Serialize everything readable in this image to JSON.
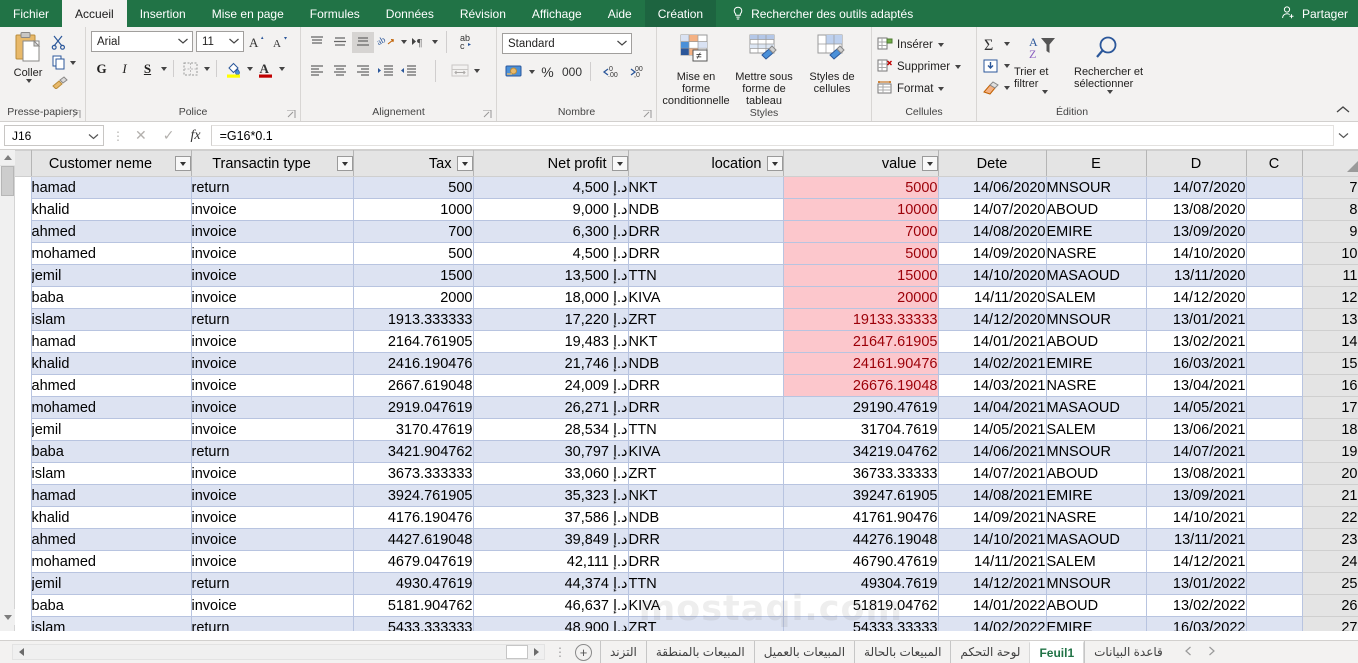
{
  "ribbon": {
    "tabs": [
      {
        "label": "Fichier",
        "active": false,
        "contextual": false
      },
      {
        "label": "Accueil",
        "active": true,
        "contextual": false
      },
      {
        "label": "Insertion",
        "active": false,
        "contextual": false
      },
      {
        "label": "Mise en page",
        "active": false,
        "contextual": false
      },
      {
        "label": "Formules",
        "active": false,
        "contextual": false
      },
      {
        "label": "Données",
        "active": false,
        "contextual": false
      },
      {
        "label": "Révision",
        "active": false,
        "contextual": false
      },
      {
        "label": "Affichage",
        "active": false,
        "contextual": false
      },
      {
        "label": "Aide",
        "active": false,
        "contextual": false
      },
      {
        "label": "Création",
        "active": false,
        "contextual": true
      }
    ],
    "tellme": "Rechercher des outils adaptés",
    "share": "Partager",
    "groups": {
      "clipboard": {
        "label": "Presse-papiers",
        "paste": "Coller"
      },
      "font": {
        "label": "Police",
        "font_name": "Arial",
        "font_size": "11",
        "bold": "G",
        "italic": "I",
        "underline": "S"
      },
      "alignment": {
        "label": "Alignement"
      },
      "number": {
        "label": "Nombre",
        "format": "Standard",
        "percent": "%",
        "thousands": "000"
      },
      "styles": {
        "label": "Styles",
        "conditional": "Mise en forme conditionnelle",
        "table": "Mettre sous forme de tableau",
        "cells": "Styles de cellules"
      },
      "cells": {
        "label": "Cellules",
        "insert": "Insérer",
        "delete": "Supprimer",
        "format": "Format"
      },
      "editing": {
        "label": "Édition",
        "sort_filter": "Trier et filtrer",
        "find_select": "Rechercher et sélectionner"
      }
    }
  },
  "formula_bar": {
    "name_box": "J16",
    "formula": "=G16*0.1"
  },
  "sheet": {
    "headers": [
      {
        "label": "Customer neme",
        "filter": true,
        "align": "center"
      },
      {
        "label": "Transactin type",
        "filter": true,
        "align": "center"
      },
      {
        "label": "Tax",
        "filter": true,
        "align": "right"
      },
      {
        "label": "Net profit",
        "filter": true,
        "align": "right"
      },
      {
        "label": "location",
        "filter": true,
        "align": "right"
      },
      {
        "label": "value",
        "filter": true,
        "align": "right"
      },
      {
        "label": "Dete",
        "filter": false,
        "align": "center"
      },
      {
        "label": "E",
        "filter": false,
        "align": "center"
      },
      {
        "label": "D",
        "filter": false,
        "align": "center"
      },
      {
        "label": "C",
        "filter": false,
        "align": "center"
      }
    ],
    "currency_symbol": "د.إ",
    "rows": [
      {
        "n": "7",
        "customer": "hamad",
        "type": "return",
        "tax": "500",
        "profit": "4,500",
        "location": "NKT",
        "value": "5000",
        "date": "14/06/2020",
        "e": "MNSOUR",
        "d": "14/07/2020",
        "c": "",
        "pink": true
      },
      {
        "n": "8",
        "customer": "khalid",
        "type": "invoice",
        "tax": "1000",
        "profit": "9,000",
        "location": "NDB",
        "value": "10000",
        "date": "14/07/2020",
        "e": "ABOUD",
        "d": "13/08/2020",
        "c": "",
        "pink": true
      },
      {
        "n": "9",
        "customer": "ahmed",
        "type": "invoice",
        "tax": "700",
        "profit": "6,300",
        "location": "DRR",
        "value": "7000",
        "date": "14/08/2020",
        "e": "EMIRE",
        "d": "13/09/2020",
        "c": "",
        "pink": true
      },
      {
        "n": "10",
        "customer": "mohamed",
        "type": "invoice",
        "tax": "500",
        "profit": "4,500",
        "location": "DRR",
        "value": "5000",
        "date": "14/09/2020",
        "e": "NASRE",
        "d": "14/10/2020",
        "c": "",
        "pink": true
      },
      {
        "n": "11",
        "customer": "jemil",
        "type": "invoice",
        "tax": "1500",
        "profit": "13,500",
        "location": "TTN",
        "value": "15000",
        "date": "14/10/2020",
        "e": "MASAOUD",
        "d": "13/11/2020",
        "c": "",
        "pink": true
      },
      {
        "n": "12",
        "customer": "baba",
        "type": "invoice",
        "tax": "2000",
        "profit": "18,000",
        "location": "KIVA",
        "value": "20000",
        "date": "14/11/2020",
        "e": "SALEM",
        "d": "14/12/2020",
        "c": "",
        "pink": true
      },
      {
        "n": "13",
        "customer": "islam",
        "type": "return",
        "tax": "1913.333333",
        "profit": "17,220",
        "location": "ZRT",
        "value": "19133.33333",
        "date": "14/12/2020",
        "e": "MNSOUR",
        "d": "13/01/2021",
        "c": "",
        "pink": true
      },
      {
        "n": "14",
        "customer": "hamad",
        "type": "invoice",
        "tax": "2164.761905",
        "profit": "19,483",
        "location": "NKT",
        "value": "21647.61905",
        "date": "14/01/2021",
        "e": "ABOUD",
        "d": "13/02/2021",
        "c": "",
        "pink": true
      },
      {
        "n": "15",
        "customer": "khalid",
        "type": "invoice",
        "tax": "2416.190476",
        "profit": "21,746",
        "location": "NDB",
        "value": "24161.90476",
        "date": "14/02/2021",
        "e": "EMIRE",
        "d": "16/03/2021",
        "c": "",
        "pink": true
      },
      {
        "n": "16",
        "customer": "ahmed",
        "type": "invoice",
        "tax": "2667.619048",
        "profit": "24,009",
        "location": "DRR",
        "value": "26676.19048",
        "date": "14/03/2021",
        "e": "NASRE",
        "d": "13/04/2021",
        "c": "",
        "pink": true
      },
      {
        "n": "17",
        "customer": "mohamed",
        "type": "invoice",
        "tax": "2919.047619",
        "profit": "26,271",
        "location": "DRR",
        "value": "29190.47619",
        "date": "14/04/2021",
        "e": "MASAOUD",
        "d": "14/05/2021",
        "c": "",
        "pink": false
      },
      {
        "n": "18",
        "customer": "jemil",
        "type": "invoice",
        "tax": "3170.47619",
        "profit": "28,534",
        "location": "TTN",
        "value": "31704.7619",
        "date": "14/05/2021",
        "e": "SALEM",
        "d": "13/06/2021",
        "c": "",
        "pink": false
      },
      {
        "n": "19",
        "customer": "baba",
        "type": "return",
        "tax": "3421.904762",
        "profit": "30,797",
        "location": "KIVA",
        "value": "34219.04762",
        "date": "14/06/2021",
        "e": "MNSOUR",
        "d": "14/07/2021",
        "c": "",
        "pink": false
      },
      {
        "n": "20",
        "customer": "islam",
        "type": "invoice",
        "tax": "3673.333333",
        "profit": "33,060",
        "location": "ZRT",
        "value": "36733.33333",
        "date": "14/07/2021",
        "e": "ABOUD",
        "d": "13/08/2021",
        "c": "",
        "pink": false
      },
      {
        "n": "21",
        "customer": "hamad",
        "type": "invoice",
        "tax": "3924.761905",
        "profit": "35,323",
        "location": "NKT",
        "value": "39247.61905",
        "date": "14/08/2021",
        "e": "EMIRE",
        "d": "13/09/2021",
        "c": "",
        "pink": false
      },
      {
        "n": "22",
        "customer": "khalid",
        "type": "invoice",
        "tax": "4176.190476",
        "profit": "37,586",
        "location": "NDB",
        "value": "41761.90476",
        "date": "14/09/2021",
        "e": "NASRE",
        "d": "14/10/2021",
        "c": "",
        "pink": false
      },
      {
        "n": "23",
        "customer": "ahmed",
        "type": "invoice",
        "tax": "4427.619048",
        "profit": "39,849",
        "location": "DRR",
        "value": "44276.19048",
        "date": "14/10/2021",
        "e": "MASAOUD",
        "d": "13/11/2021",
        "c": "",
        "pink": false
      },
      {
        "n": "24",
        "customer": "mohamed",
        "type": "invoice",
        "tax": "4679.047619",
        "profit": "42,111",
        "location": "DRR",
        "value": "46790.47619",
        "date": "14/11/2021",
        "e": "SALEM",
        "d": "14/12/2021",
        "c": "",
        "pink": false
      },
      {
        "n": "25",
        "customer": "jemil",
        "type": "return",
        "tax": "4930.47619",
        "profit": "44,374",
        "location": "TTN",
        "value": "49304.7619",
        "date": "14/12/2021",
        "e": "MNSOUR",
        "d": "13/01/2022",
        "c": "",
        "pink": false
      },
      {
        "n": "26",
        "customer": "baba",
        "type": "invoice",
        "tax": "5181.904762",
        "profit": "46,637",
        "location": "KIVA",
        "value": "51819.04762",
        "date": "14/01/2022",
        "e": "ABOUD",
        "d": "13/02/2022",
        "c": "",
        "pink": false
      },
      {
        "n": "27",
        "customer": "islam",
        "type": "return",
        "tax": "5433.333333",
        "profit": "48,900",
        "location": "ZRT",
        "value": "54333.33333",
        "date": "14/02/2022",
        "e": "EMIRE",
        "d": "16/03/2022",
        "c": "",
        "pink": false
      }
    ],
    "watermark": "mostaqi.com"
  },
  "statusbar": {
    "add_sheet": "+",
    "sheet_tabs": [
      {
        "label": "التزند",
        "active": false
      },
      {
        "label": "المبيعات بالمنطقة",
        "active": false
      },
      {
        "label": "المبيعات بالعميل",
        "active": false
      },
      {
        "label": "المبيعات بالحالة",
        "active": false
      },
      {
        "label": "لوحة التحكم",
        "active": false
      },
      {
        "label": "Feuil1",
        "active": true
      },
      {
        "label": "قاعدة البيانات",
        "active": false
      }
    ]
  },
  "colors": {
    "brand_green": "#217346",
    "selection_band": "#dde3f2",
    "conditional_pink_bg": "#fcc7cc",
    "conditional_pink_text": "#9c0008"
  }
}
